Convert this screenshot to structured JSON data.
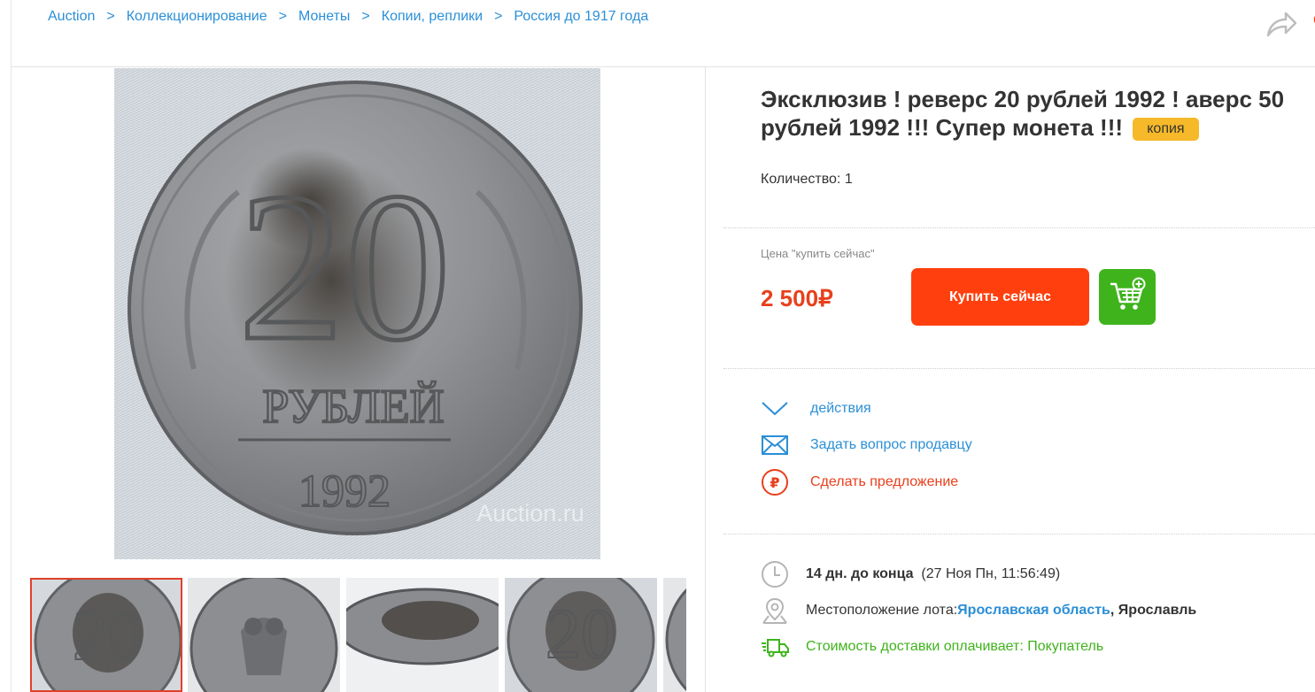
{
  "breadcrumb": [
    "Auction",
    "Коллекционирование",
    "Монеты",
    "Копии, реплики",
    "Россия до 1917 года"
  ],
  "breadcrumb_sep": ">",
  "photo": {
    "coin_denomination": "20",
    "coin_word": "РУБЛЕЙ",
    "coin_year": "1992",
    "watermark": "Auction.ru"
  },
  "lot": {
    "title": "Эксклюзив ! реверс 20 рублей 1992 ! аверс 50 рублей 1992 !!! Супер монета !!!",
    "badge": "копия",
    "quantity": "Количество: 1"
  },
  "price": {
    "label": "Цена \"купить сейчас\"",
    "value": "2 500₽",
    "buy_label": "Купить сейчас"
  },
  "actions": [
    {
      "label": "действия",
      "color": "#2b8fd6"
    },
    {
      "label": "Задать вопрос продавцу",
      "color": "#2b8fd6"
    },
    {
      "label": "Сделать предложение",
      "color": "#e8401c"
    }
  ],
  "details": {
    "time_bold": "14 дн. до конца",
    "time_rest": "(27 Ноя Пн, 11:56:49)",
    "location_label": "Местоположение лота:",
    "location_region": "Ярославская область",
    "location_sep": ",",
    "location_city": "Ярославль",
    "delivery": "Стоимость доставки оплачивает: Покупатель"
  },
  "colors": {
    "link": "#2b8fd6",
    "accent": "#e8401c",
    "buy": "#ff3f0e",
    "cart": "#3fb31c",
    "badge": "#f6b929",
    "delivery": "#3fb31c"
  },
  "icons": [
    "share-icon",
    "chevron-down-icon",
    "envelope-icon",
    "ruble-circle-icon",
    "clock-icon",
    "location-pin-icon",
    "delivery-truck-icon",
    "cart-add-icon"
  ]
}
